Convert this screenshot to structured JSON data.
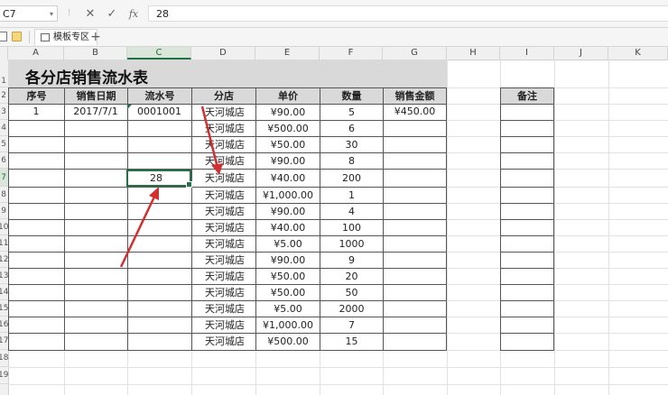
{
  "formula_bar": {
    "name_box": "C7",
    "cancel_icon": "✕",
    "confirm_icon": "✓",
    "fx_label": "fx",
    "formula_value": "28"
  },
  "tabs": {
    "doc_icon": "document-icon",
    "folder_icon": "folder-icon",
    "template_tab_label": "模板专区",
    "add_tab_label": "+"
  },
  "columns": [
    "A",
    "B",
    "C",
    "D",
    "E",
    "F",
    "G",
    "H",
    "I",
    "J",
    "K"
  ],
  "rows": [
    "1",
    "2",
    "3",
    "4",
    "5",
    "6",
    "7",
    "8",
    "9",
    "10",
    "11",
    "12",
    "13",
    "14",
    "15",
    "16",
    "17",
    "18",
    "19"
  ],
  "sheet": {
    "title": "各分店销售流水表",
    "headers": {
      "seq": "序号",
      "date": "销售日期",
      "serial": "流水号",
      "store": "分店",
      "price": "单价",
      "qty": "数量",
      "amount": "销售金额",
      "note": "备注"
    },
    "first_row": {
      "seq": "1",
      "date": "2017/7/1",
      "serial": "0001001",
      "amount": "¥450.00"
    },
    "active_cell_value": "28",
    "records": [
      {
        "store": "天河城店",
        "price": "¥90.00",
        "qty": "5"
      },
      {
        "store": "天河城店",
        "price": "¥500.00",
        "qty": "6"
      },
      {
        "store": "天河城店",
        "price": "¥50.00",
        "qty": "30"
      },
      {
        "store": "天河城店",
        "price": "¥90.00",
        "qty": "8"
      },
      {
        "store": "天河城店",
        "price": "¥40.00",
        "qty": "200"
      },
      {
        "store": "天河城店",
        "price": "¥1,000.00",
        "qty": "1"
      },
      {
        "store": "天河城店",
        "price": "¥90.00",
        "qty": "4"
      },
      {
        "store": "天河城店",
        "price": "¥40.00",
        "qty": "100"
      },
      {
        "store": "天河城店",
        "price": "¥5.00",
        "qty": "1000"
      },
      {
        "store": "天河城店",
        "price": "¥90.00",
        "qty": "9"
      },
      {
        "store": "天河城店",
        "price": "¥50.00",
        "qty": "20"
      },
      {
        "store": "天河城店",
        "price": "¥50.00",
        "qty": "50"
      },
      {
        "store": "天河城店",
        "price": "¥5.00",
        "qty": "2000"
      },
      {
        "store": "天河城店",
        "price": "¥1,000.00",
        "qty": "7"
      },
      {
        "store": "天河城店",
        "price": "¥500.00",
        "qty": "15"
      }
    ]
  },
  "colors": {
    "accent_green": "#217346",
    "header_fill": "#d9d9d9",
    "annotation_arrow": "#d32f2f"
  }
}
